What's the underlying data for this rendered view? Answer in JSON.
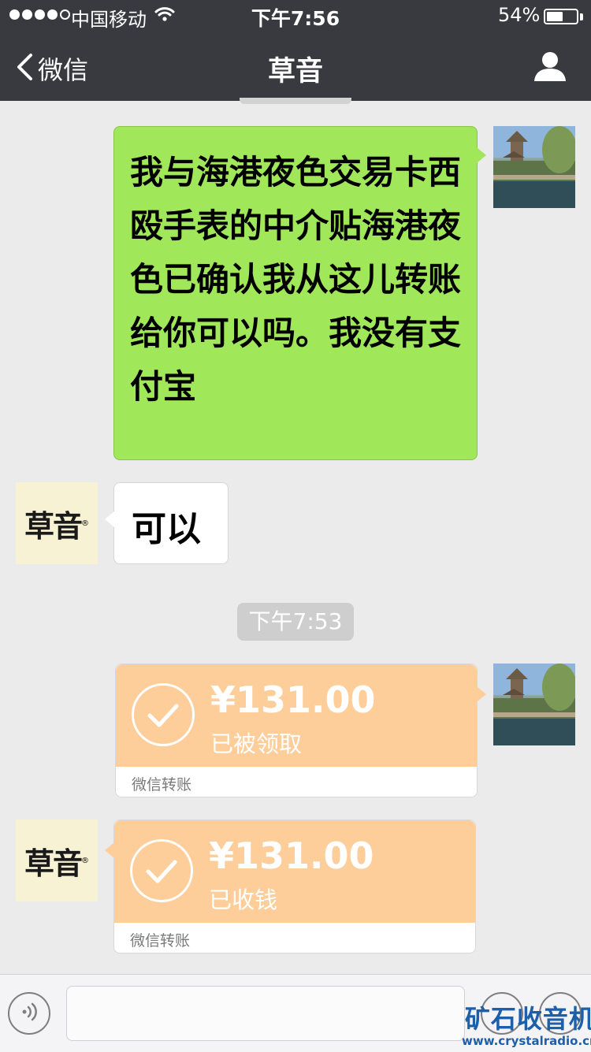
{
  "status_bar": {
    "carrier": "中国移动",
    "time": "下午7:56",
    "battery_percent": "54%",
    "battery_level": 0.54,
    "signal_bars": 4
  },
  "nav": {
    "back_label": "微信",
    "title": "草音",
    "back_icon": "chevron-left-icon",
    "profile_icon": "person-icon"
  },
  "contact_logo": "草音",
  "messages": [
    {
      "from": "me",
      "text": "我与海港夜色交易卡西殴手表的中介贴海港夜色已确认我从这儿转账给你可以吗。我没有支付宝"
    },
    {
      "from": "other",
      "text": "可以"
    }
  ],
  "time_separator": "下午7:53",
  "transfers": [
    {
      "from": "me",
      "amount": "¥131.00",
      "status": "已被领取",
      "footer": "微信转账"
    },
    {
      "from": "other",
      "amount": "¥131.00",
      "status": "已收钱",
      "footer": "微信转账"
    }
  ],
  "input_bar": {
    "voice_icon": "voice-icon",
    "emoji_icon": "emoji-icon",
    "more_icon": "plus-icon"
  },
  "watermark": {
    "title": "矿石收音机",
    "url": "www.crystalradio.cn"
  },
  "colors": {
    "header_bg": "#393a3f",
    "chat_bg": "#ebebeb",
    "sent_bubble": "#a0e75a",
    "transfer_card": "#fdce9a",
    "watermark": "#1d5fa8"
  }
}
